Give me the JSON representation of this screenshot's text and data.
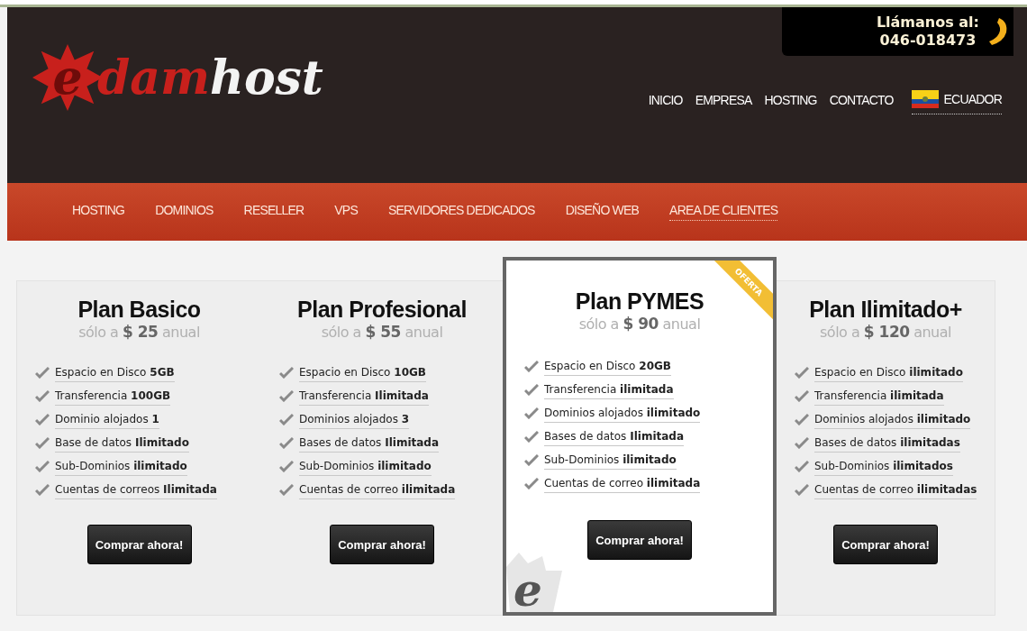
{
  "header": {
    "logo": {
      "mark": "e",
      "red": "dam",
      "white": "host"
    },
    "phone": {
      "label": "Llámanos al:",
      "number": "046-018473"
    },
    "top_nav": [
      {
        "label": "INICIO"
      },
      {
        "label": "EMPRESA"
      },
      {
        "label": "HOSTING"
      },
      {
        "label": "CONTACTO"
      }
    ],
    "country": {
      "label": "ECUADOR"
    }
  },
  "main_nav": [
    {
      "label": "HOSTING",
      "selected": false
    },
    {
      "label": "DOMINIOS",
      "selected": false
    },
    {
      "label": "RESELLER",
      "selected": false
    },
    {
      "label": "VPS",
      "selected": false
    },
    {
      "label": "SERVIDORES DEDICADOS",
      "selected": false
    },
    {
      "label": "DISEÑO WEB",
      "selected": false
    },
    {
      "label": "AREA DE CLIENTES",
      "selected": true
    }
  ],
  "plans": [
    {
      "title": "Plan Basico",
      "price": "sólo a **$ 25** anual",
      "featured": false,
      "features": [
        "Espacio en Disco **5GB**",
        "Transferencia **100GB**",
        "Dominio alojados **1**",
        "Base de datos **Ilimitado**",
        "Sub-Dominios **ilimitado**",
        "Cuentas de correos **Ilimitada**"
      ],
      "button": "Comprar ahora!"
    },
    {
      "title": "Plan Profesional",
      "price": "sólo a **$ 55** anual",
      "featured": false,
      "features": [
        "Espacio en Disco **10GB**",
        "Transferencia **Ilimitada**",
        "Dominios alojados **3**",
        "Bases de datos **Ilimitada**",
        "Sub-Dominios **ilimitado**",
        "Cuentas de correo **ilimitada**"
      ],
      "button": "Comprar ahora!"
    },
    {
      "title": "Plan PYMES",
      "price": "sólo a **$ 90** anual",
      "featured": true,
      "ribbon": "OFERTA",
      "corner_mark": "e",
      "features": [
        "Espacio en Disco **20GB**",
        "Transferencia **ilimitada**",
        "Dominios alojados **ilimitado**",
        "Bases de datos **Ilimitada**",
        "Sub-Dominios **ilimitado**",
        "Cuentas de correo **ilimitada**"
      ],
      "button": "Comprar ahora!"
    },
    {
      "title": "Plan Ilimitado+",
      "price": "sólo a **$ 120** anual",
      "featured": false,
      "features": [
        "Espacio en Disco **ilimitado**",
        "Transferencia **ilimitada**",
        "Dominios alojados **ilimitado**",
        "Bases de datos **ilimitadas**",
        "Sub-Dominios **ilimitados**",
        "Cuentas de correo **ilimitadas**"
      ],
      "button": "Comprar ahora!"
    }
  ]
}
